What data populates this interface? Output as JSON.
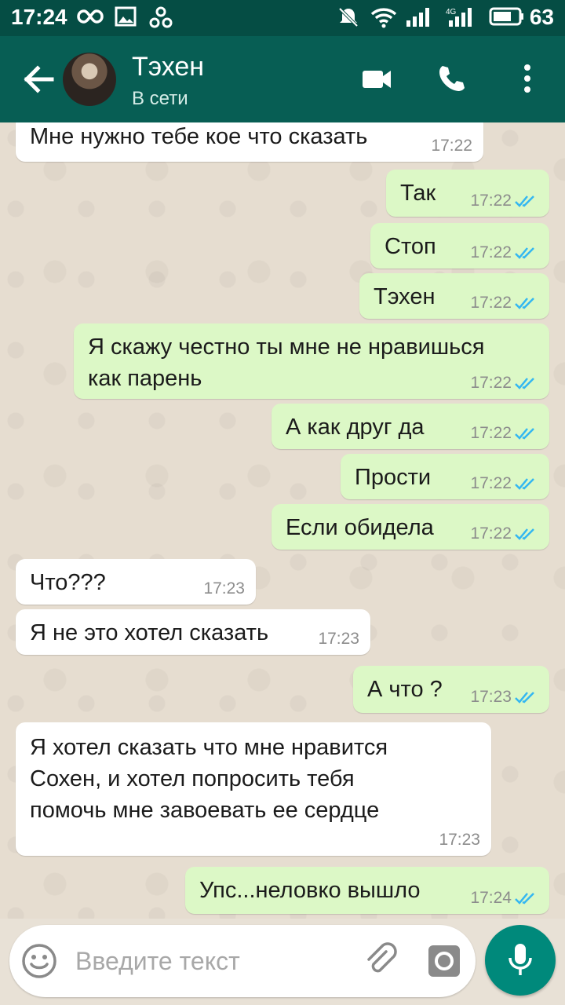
{
  "status_bar": {
    "time": "17:24",
    "battery_level": "63"
  },
  "header": {
    "contact_name": "Тэхен",
    "contact_status": "В сети",
    "icons": [
      "back-arrow-icon",
      "video-call-icon",
      "phone-icon",
      "more-vert-icon"
    ]
  },
  "messages": [
    {
      "dir": "in",
      "text": "Мне нужно тебе кое что сказать",
      "time": "17:22",
      "read": false
    },
    {
      "dir": "out",
      "text": "Так",
      "time": "17:22",
      "read": true
    },
    {
      "dir": "out",
      "text": "Стоп",
      "time": "17:22",
      "read": true
    },
    {
      "dir": "out",
      "text": "Тэхен",
      "time": "17:22",
      "read": true
    },
    {
      "dir": "out",
      "text": "Я скажу честно ты мне не нравишься\nкак парень",
      "time": "17:22",
      "read": true
    },
    {
      "dir": "out",
      "text": "А как друг да",
      "time": "17:22",
      "read": true
    },
    {
      "dir": "out",
      "text": "Прости",
      "time": "17:22",
      "read": true
    },
    {
      "dir": "out",
      "text": "Если обидела",
      "time": "17:22",
      "read": true
    },
    {
      "dir": "in",
      "text": "Что???",
      "time": "17:23",
      "read": false
    },
    {
      "dir": "in",
      "text": "Я не это хотел сказать",
      "time": "17:23",
      "read": false
    },
    {
      "dir": "out",
      "text": "А что ?",
      "time": "17:23",
      "read": true
    },
    {
      "dir": "in",
      "text": "Я хотел сказать что мне нравится\nСохен, и хотел попросить тебя\nпомочь мне завоевать ее сердце",
      "time": "17:23",
      "read": false
    },
    {
      "dir": "out",
      "text": "Упс...неловко вышло",
      "time": "17:24",
      "read": true
    }
  ],
  "input": {
    "placeholder": "Введите текст"
  },
  "colors": {
    "header": "#075e54",
    "status_bar": "#054d44",
    "outgoing_bubble": "#dcf8c6",
    "incoming_bubble": "#ffffff",
    "read_tick": "#34b7f1",
    "mic_button": "#00897b"
  }
}
